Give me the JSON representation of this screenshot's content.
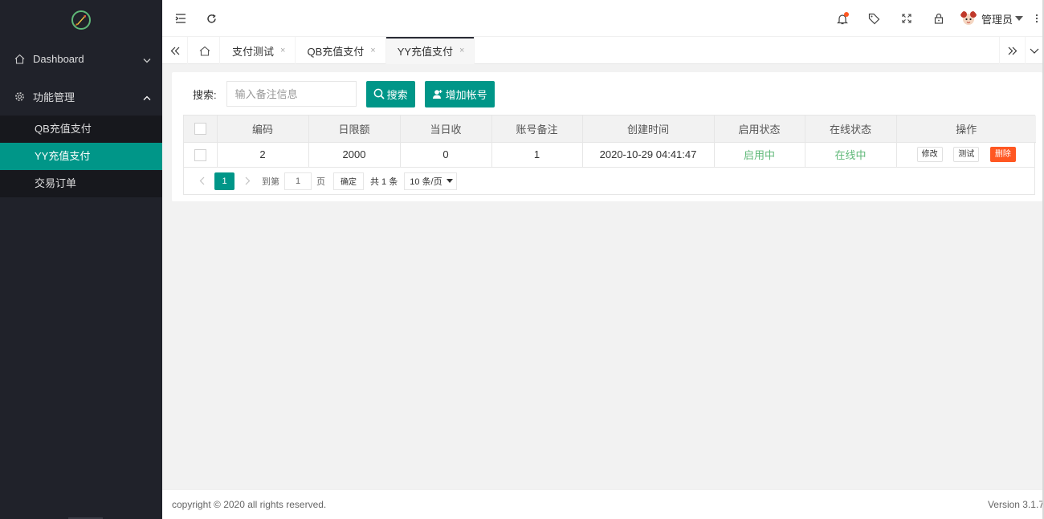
{
  "sidebar": {
    "logo_icon": "rocket-icon",
    "groups": [
      {
        "label": "Dashboard",
        "icon": "home-icon",
        "expanded": false
      },
      {
        "label": "功能管理",
        "icon": "gear-icon",
        "expanded": true
      }
    ],
    "subitems": [
      "QB充值支付",
      "YY充值支付",
      "交易订单"
    ],
    "active_subitem": "YY充值支付"
  },
  "header": {
    "user_name": "管理员",
    "icons": [
      "menu-fold-icon",
      "refresh-icon",
      "bell-icon",
      "tag-icon",
      "fullscreen-icon",
      "lock-icon",
      "more-icon"
    ]
  },
  "tabs": {
    "items": [
      "支付测试",
      "QB充值支付",
      "YY充值支付"
    ],
    "active": "YY充值支付",
    "close_glyph": "×"
  },
  "search": {
    "label": "搜索:",
    "placeholder": "输入备注信息",
    "search_button": "搜索",
    "add_button": "增加帐号"
  },
  "table": {
    "headers": [
      "编码",
      "日限额",
      "当日收",
      "账号备注",
      "创建时间",
      "启用状态",
      "在线状态",
      "操作"
    ],
    "rows": [
      {
        "id": "2",
        "limit": "2000",
        "today": "0",
        "note": "1",
        "created": "2020-10-29 04:41:47",
        "enabled": "启用中",
        "online": "在线中"
      }
    ],
    "actions": {
      "edit": "修改",
      "test": "测试",
      "delete": "删除"
    }
  },
  "pager": {
    "current": "1",
    "goto_prefix": "到第",
    "goto_value": "1",
    "goto_suffix": "页",
    "confirm": "确定",
    "total": "共 1 条",
    "page_size": "10 条/页"
  },
  "footer": {
    "copyright": "copyright © 2020 all rights reserved.",
    "version": "Version 3.1.7"
  },
  "colors": {
    "sidebar_bg": "#20222a",
    "accent": "#009688",
    "danger": "#ff5722",
    "status_green": "#5fb878"
  }
}
